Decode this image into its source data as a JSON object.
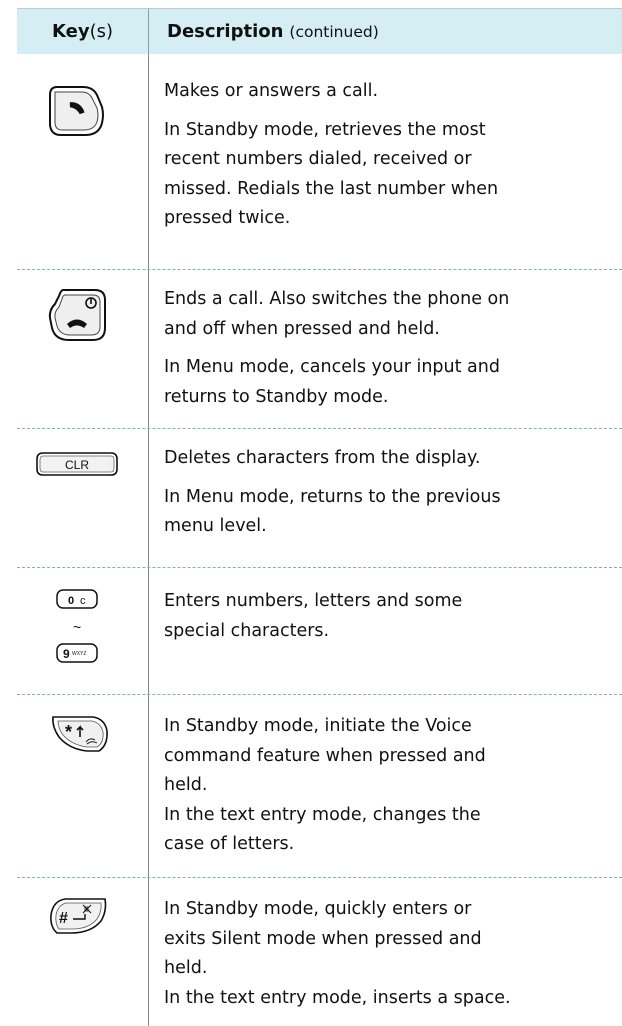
{
  "header": {
    "key_bold": "Key",
    "key_suffix": "(s)",
    "desc_bold": "Description",
    "desc_suffix": "(continued)"
  },
  "rows": [
    {
      "key_icon": "send-key-icon",
      "lines": [
        "Makes or answers a call.",
        "In Standby mode, retrieves the most\nrecent numbers dialed, received or\nmissed. Redials the last number when\npressed twice."
      ]
    },
    {
      "key_icon": "end-power-key-icon",
      "lines": [
        "Ends a call. Also switches the phone on\nand off when pressed and held.",
        "In Menu mode, cancels your input and\nreturns to Standby mode."
      ]
    },
    {
      "key_icon": "clr-key-icon",
      "key_label": "CLR",
      "lines": [
        "Deletes characters from the display.",
        "In Menu mode, returns to the previous\nmenu level."
      ]
    },
    {
      "key_icon": "number-keys-icon",
      "key_label_top": "0",
      "key_label_tilde": "~",
      "key_label_bottom": "9",
      "key_label_bottom_small": "WXYZ",
      "lines": [
        "Enters numbers, letters and some\nspecial characters."
      ]
    },
    {
      "key_icon": "star-key-icon",
      "key_label": "*",
      "lines": [
        "In Standby mode, initiate the Voice\ncommand feature when pressed and\nheld.\nIn the text entry mode, changes the\ncase of letters."
      ]
    },
    {
      "key_icon": "hash-key-icon",
      "key_label": "#",
      "lines": [
        "In Standby mode, quickly enters or\nexits Silent mode when pressed and\nheld.\nIn the text entry mode, inserts a space."
      ]
    }
  ]
}
